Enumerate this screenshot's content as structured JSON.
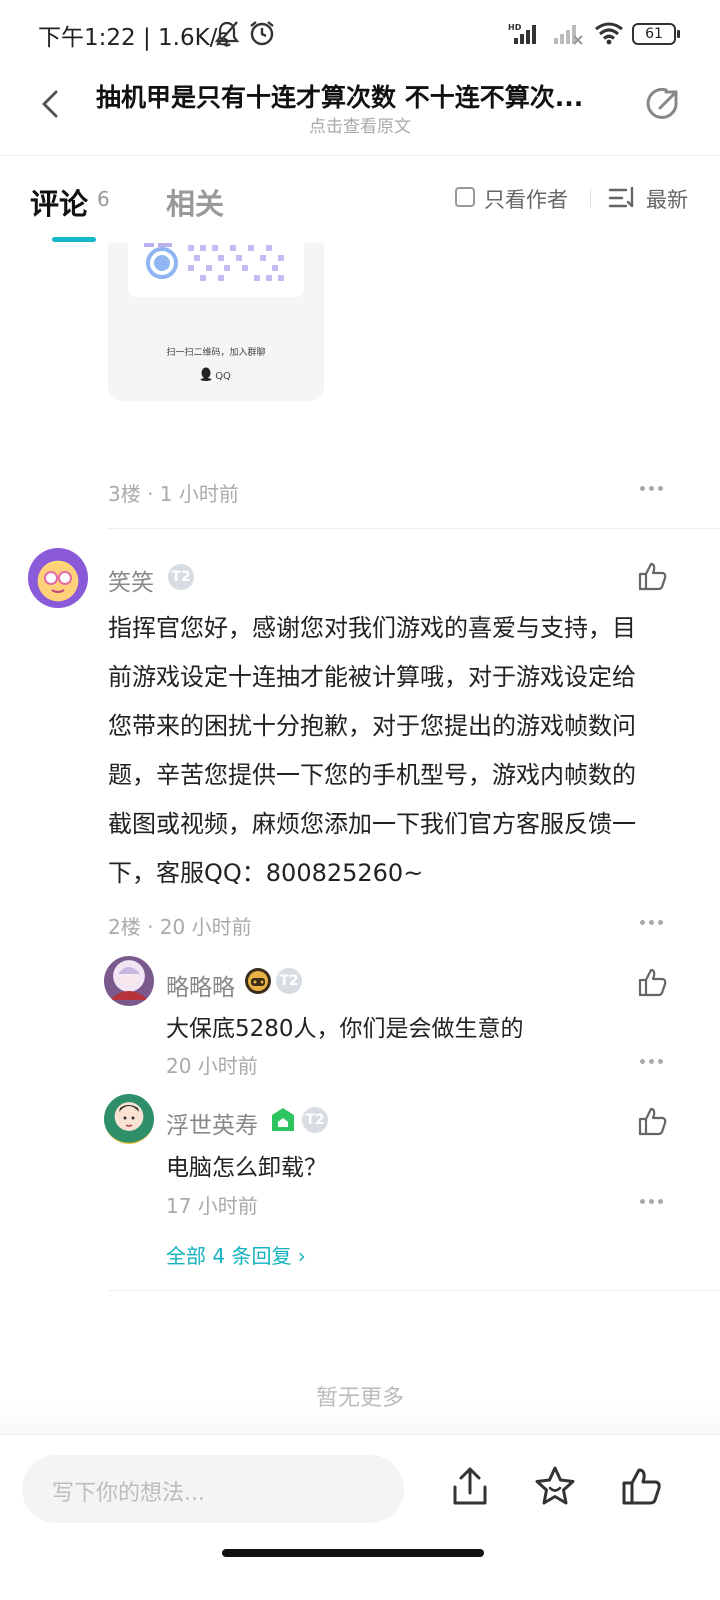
{
  "status_bar": {
    "time_speed": "下午1:22 | 1.6K/s",
    "battery": "61"
  },
  "header": {
    "title": "抽机甲是只有十连才算次数 不十连不算次...",
    "subtitle": "点击查看原文"
  },
  "tabs": {
    "comments_label": "评论",
    "comments_count": "6",
    "related_label": "相关",
    "author_only_label": "只看作者",
    "sort_label": "最新"
  },
  "qr_card": {
    "caption": "扫一扫二维码，加入群聊",
    "brand": "QQ"
  },
  "floor3": {
    "meta": "3楼 · 1 小时前"
  },
  "floor2": {
    "username": "笑笑",
    "level_badge": "T2",
    "lines": [
      "指挥官您好，感谢您对我们游戏的喜爱与支持，目",
      "前游戏设定十连抽才能被计算哦，对于游戏设定给",
      "您带来的困扰十分抱歉，对于您提出的游戏帧数问",
      "题，辛苦您提供一下您的手机型号，游戏内帧数的",
      "截图或视频，麻烦您添加一下我们官方客服反馈一",
      "下，客服QQ：800825260~"
    ],
    "meta": "2楼 · 20 小时前"
  },
  "replies": [
    {
      "username": "略略略",
      "text": "大保底5280人，你们是会做生意的",
      "time": "20 小时前"
    },
    {
      "username": "浮世英寿",
      "text": "电脑怎么卸载？",
      "time": "17 小时前"
    }
  ],
  "all_replies_label": "全部 4 条回复 ›",
  "no_more_label": "暂无更多",
  "bottom_bar": {
    "input_placeholder": "写下你的想法..."
  }
}
